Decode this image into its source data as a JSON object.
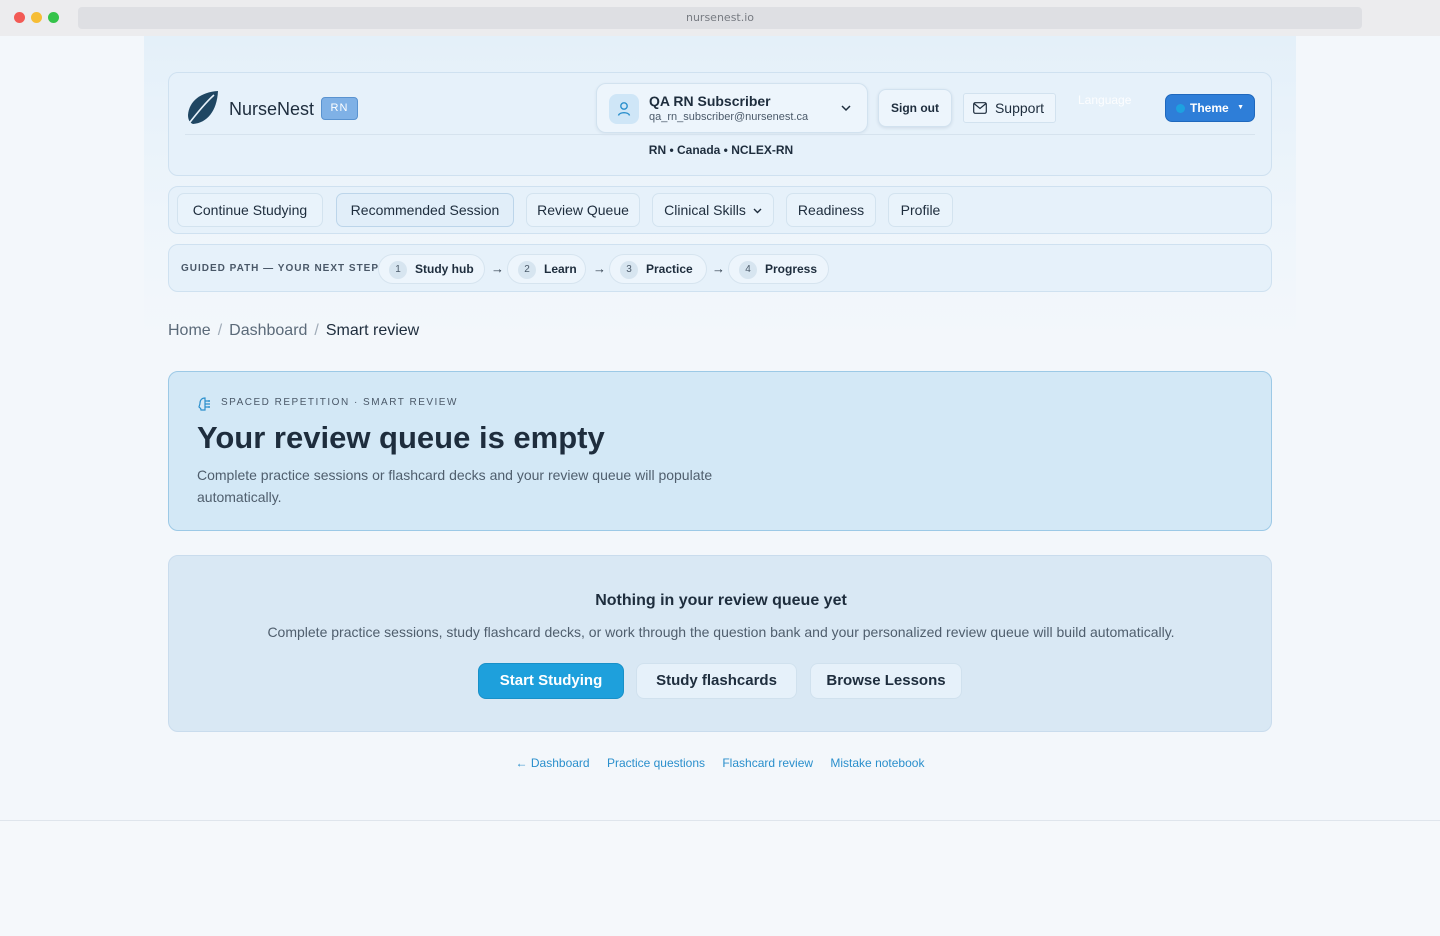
{
  "browser": {
    "url": "nursenest.io"
  },
  "header": {
    "brand": "NurseNest",
    "badge": "RN",
    "user": {
      "name": "QA RN Subscriber",
      "email": "qa_rn_subscriber@nursenest.ca"
    },
    "sign_out": "Sign out",
    "support": "Support",
    "language_label": "Language",
    "language_value": "",
    "theme": "Theme",
    "meta": "RN • Canada • NCLEX-RN"
  },
  "nav": {
    "items": [
      {
        "label": "Continue Studying"
      },
      {
        "label": "Recommended Session"
      },
      {
        "label": "Review Queue"
      },
      {
        "label": "Clinical Skills"
      },
      {
        "label": "Readiness"
      },
      {
        "label": "Profile"
      }
    ]
  },
  "guided_path": {
    "label": "GUIDED PATH — YOUR NEXT STEP",
    "steps": [
      {
        "num": "1",
        "label": "Study hub"
      },
      {
        "num": "2",
        "label": "Learn"
      },
      {
        "num": "3",
        "label": "Practice"
      },
      {
        "num": "4",
        "label": "Progress"
      }
    ],
    "arrow": "→"
  },
  "breadcrumb": {
    "items": [
      "Home",
      "Dashboard",
      "Smart review"
    ],
    "separator": "/"
  },
  "hero": {
    "kicker": "SPACED REPETITION · SMART REVIEW",
    "title": "Your review queue is empty",
    "description": "Complete practice sessions or flashcard decks and your review queue will populate automatically."
  },
  "empty_state": {
    "title": "Nothing in your review queue yet",
    "description": "Complete practice sessions, study flashcard decks, or work through the question bank and your personalized review queue will build automatically.",
    "buttons": {
      "primary": "Start Studying",
      "flashcards": "Study flashcards",
      "lessons": "Browse Lessons"
    }
  },
  "bottom_links": [
    "← Dashboard",
    "Practice questions",
    "Flashcard review",
    "Mistake notebook"
  ],
  "colors": {
    "accent": "#1ea0dc",
    "theme_button": "#2e7ed8",
    "link": "#2a8fcc",
    "text": "#1e2d3d"
  }
}
